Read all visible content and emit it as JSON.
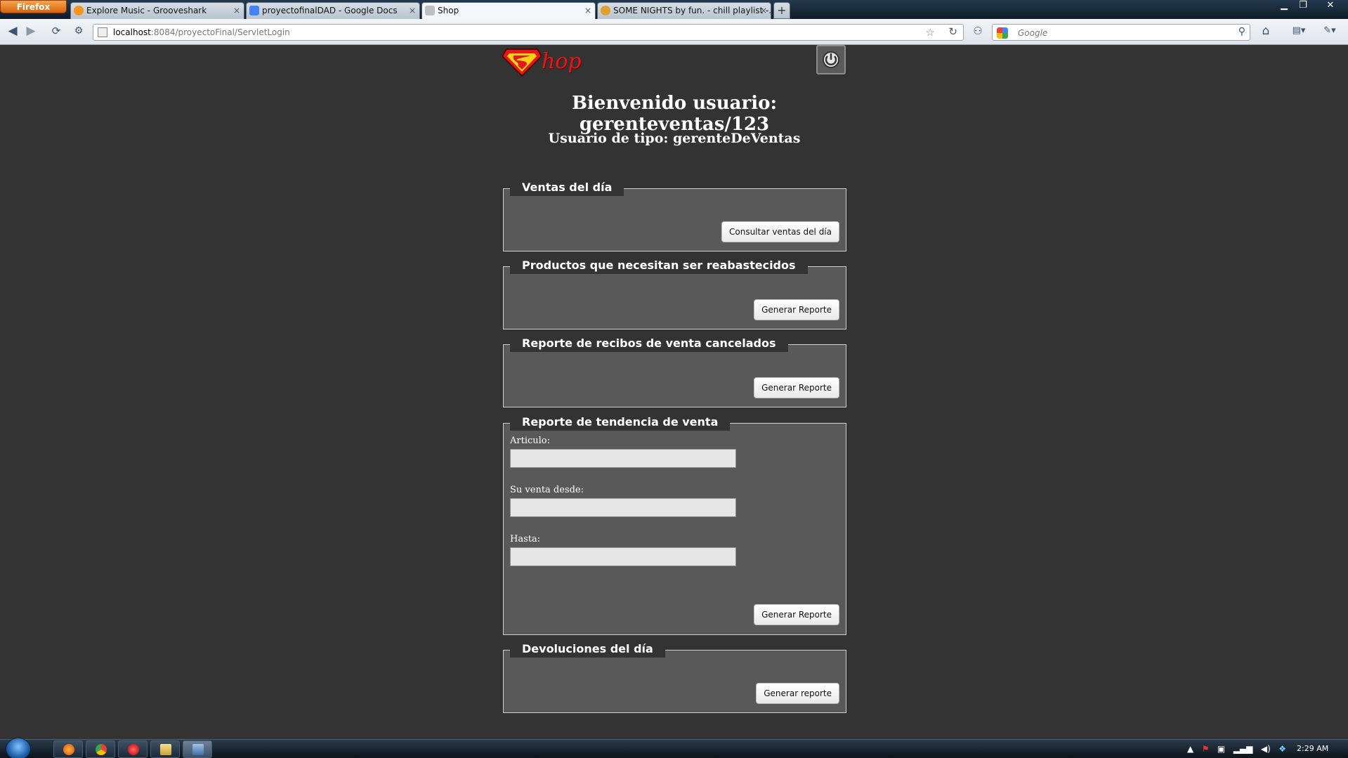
{
  "browser": {
    "menu_button": "Firefox",
    "tabs": [
      {
        "title": "Explore Music - Grooveshark",
        "favicon_color": "#f7941d"
      },
      {
        "title": "proyectofinalDAD - Google Docs",
        "favicon_color": "#4285f4"
      },
      {
        "title": "Shop",
        "favicon_color": "#c0c0c0"
      },
      {
        "title": "SOME NIGHTS by fun. - chill playlist -...",
        "favicon_color": "#e0a030"
      }
    ],
    "url_host": "localhost",
    "url_rest": ":8084/proyectoFinal/ServletLogin",
    "search_placeholder": "Google"
  },
  "header": {
    "logo_text": "hop",
    "welcome": "Bienvenido usuario: gerenteventas/123",
    "user_type": "Usuario de tipo: gerenteDeVentas"
  },
  "panels": {
    "ventas_dia": {
      "legend": "Ventas del día",
      "button": "Consultar ventas del día"
    },
    "reabastecer": {
      "legend": "Productos que necesitan ser reabastecidos",
      "button": "Generar Reporte"
    },
    "cancelados": {
      "legend": "Reporte de recibos de venta cancelados",
      "button": "Generar Reporte"
    },
    "tendencia": {
      "legend": "Reporte de tendencia de venta",
      "articulo_label": "Articulo:",
      "desde_label": "Su venta desde:",
      "hasta_label": "Hasta:",
      "button": "Generar Reporte"
    },
    "devoluciones": {
      "legend": "Devoluciones del día",
      "button": "Generar reporte"
    }
  },
  "taskbar": {
    "clock": "2:29 AM"
  }
}
